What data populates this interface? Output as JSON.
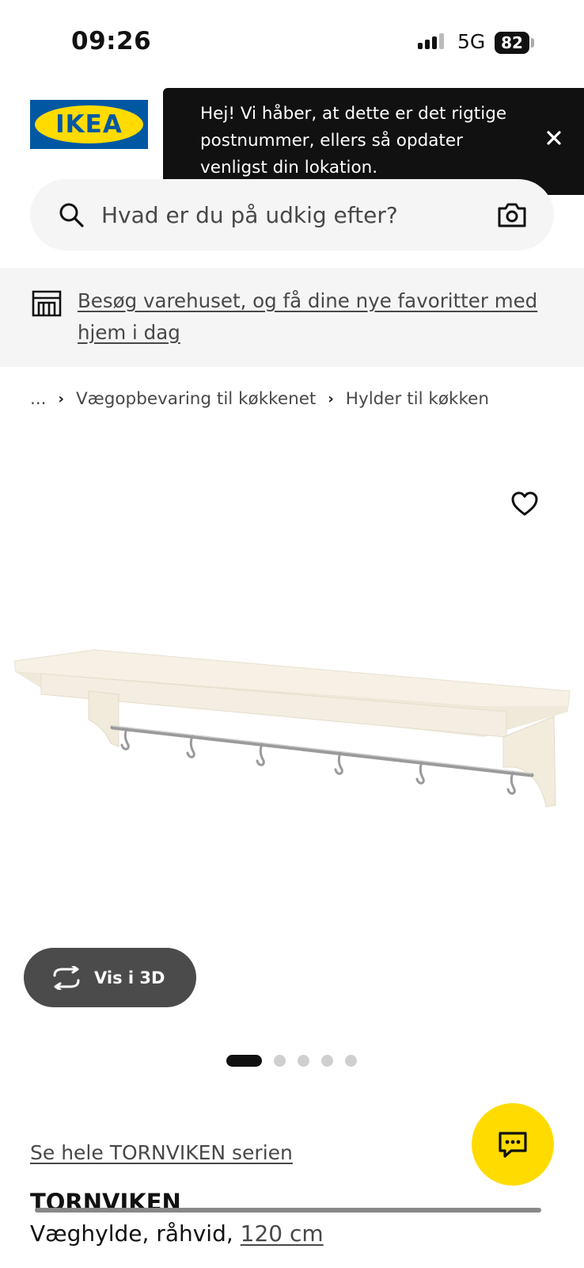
{
  "status_bar": {
    "time": "09:26",
    "network": "5G",
    "battery": "82"
  },
  "toast": {
    "message": "Hej! Vi håber, at dette er det rigtige postnummer, ellers så opdater venligst din lokation."
  },
  "search": {
    "placeholder": "Hvad er du på udkig efter?"
  },
  "banner": {
    "link_text": "Besøg varehuset, og få dine nye favoritter med hjem i dag"
  },
  "breadcrumb": {
    "items": [
      "...",
      "Vægopbevaring til køkkenet",
      "Hylder til køkken"
    ]
  },
  "view3d": {
    "label": "Vis i 3D"
  },
  "carousel": {
    "total": 5,
    "active": 1
  },
  "product": {
    "series_link": "Se hele TORNVIKEN serien",
    "name": "TORNVIKEN",
    "description": "Væghylde, råhvid,",
    "size": "120 cm"
  },
  "colors": {
    "brand_blue": "#0058a3",
    "brand_yellow": "#ffdb00",
    "toast_bg": "#111111"
  },
  "icons": [
    "search-icon",
    "camera-icon",
    "store-icon",
    "close-icon",
    "heart-icon",
    "rotate-3d-icon",
    "chat-icon"
  ]
}
